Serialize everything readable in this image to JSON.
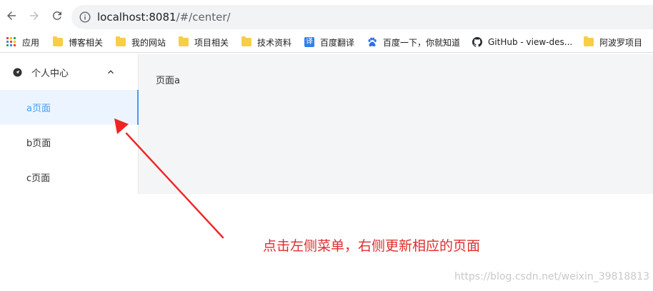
{
  "browser": {
    "url_host": "localhost:8081",
    "url_path": "/#/center/",
    "bookmarks": [
      {
        "label": "应用",
        "icon": "apps-grid-icon"
      },
      {
        "label": "博客相关",
        "icon": "folder-icon"
      },
      {
        "label": "我的网站",
        "icon": "folder-icon"
      },
      {
        "label": "项目相关",
        "icon": "folder-icon"
      },
      {
        "label": "技术资料",
        "icon": "folder-icon"
      },
      {
        "label": "百度翻译",
        "icon": "baidu-translate-icon",
        "icon_text": "译"
      },
      {
        "label": "百度一下，你就知道",
        "icon": "baidu-paw-icon"
      },
      {
        "label": "GitHub - view-des...",
        "icon": "github-icon"
      },
      {
        "label": "阿波罗项目",
        "icon": "folder-icon"
      }
    ]
  },
  "sidebar": {
    "submenu_title": "个人中心",
    "items": [
      {
        "label": "a页面",
        "active": true
      },
      {
        "label": "b页面",
        "active": false
      },
      {
        "label": "c页面",
        "active": false
      }
    ]
  },
  "main": {
    "content": "页面a"
  },
  "annotation": {
    "text": "点击左侧菜单，右侧更新相应的页面",
    "color": "#e02c2c"
  },
  "watermark": "https://blog.csdn.net/weixin_39818813",
  "colors": {
    "accent": "#409eff",
    "active_bg": "#ecf5ff",
    "main_bg": "#f4f5f7"
  }
}
